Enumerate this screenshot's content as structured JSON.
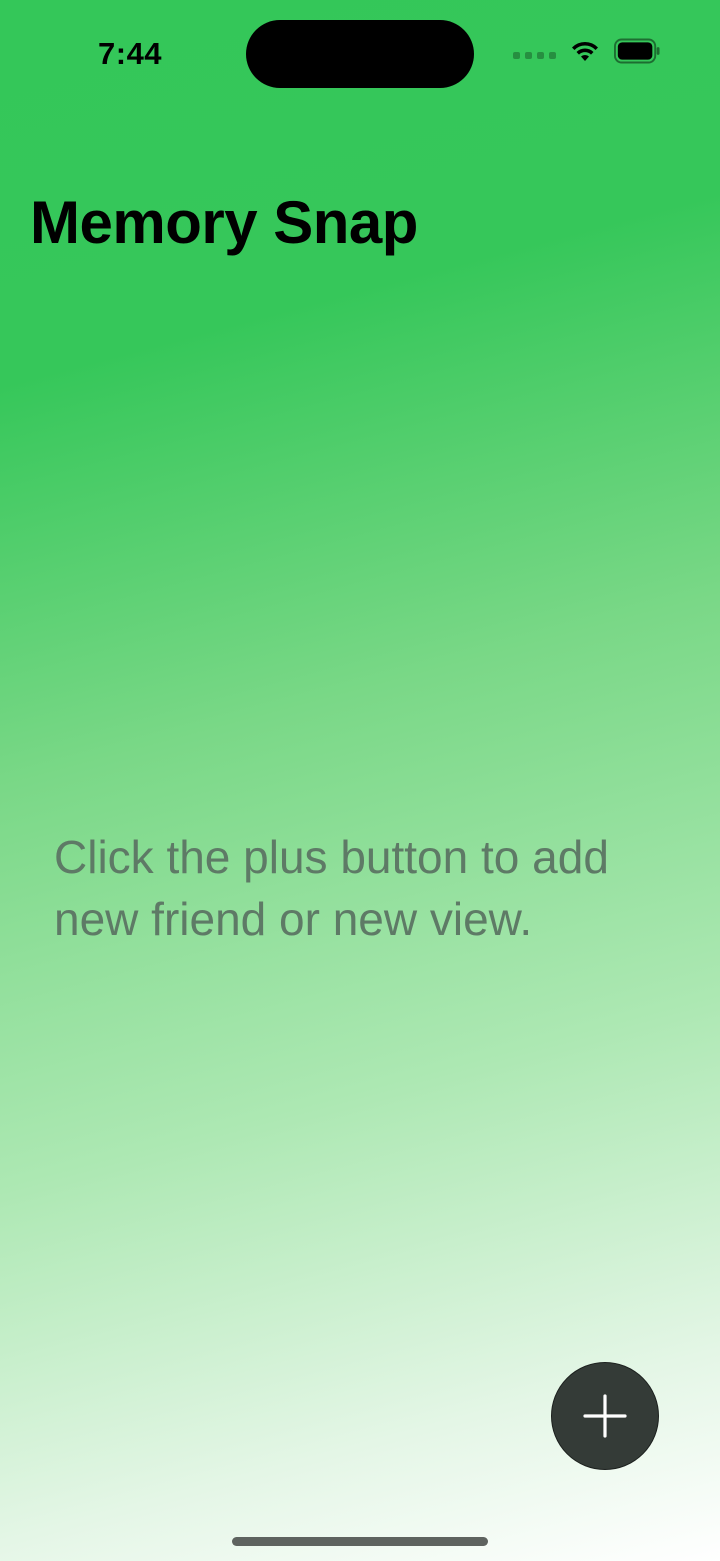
{
  "status_bar": {
    "time": "7:44",
    "icons": [
      "signal-dots-icon",
      "wifi-icon",
      "battery-icon"
    ]
  },
  "header": {
    "title": "Memory Snap"
  },
  "main": {
    "empty_message": "Click the plus button to add new friend or new view."
  },
  "fab": {
    "icon": "plus-icon",
    "background": "#343b37"
  },
  "colors": {
    "background_top": "#34c759",
    "background_bottom": "#ffffff",
    "message_text": "#5e7a66"
  }
}
